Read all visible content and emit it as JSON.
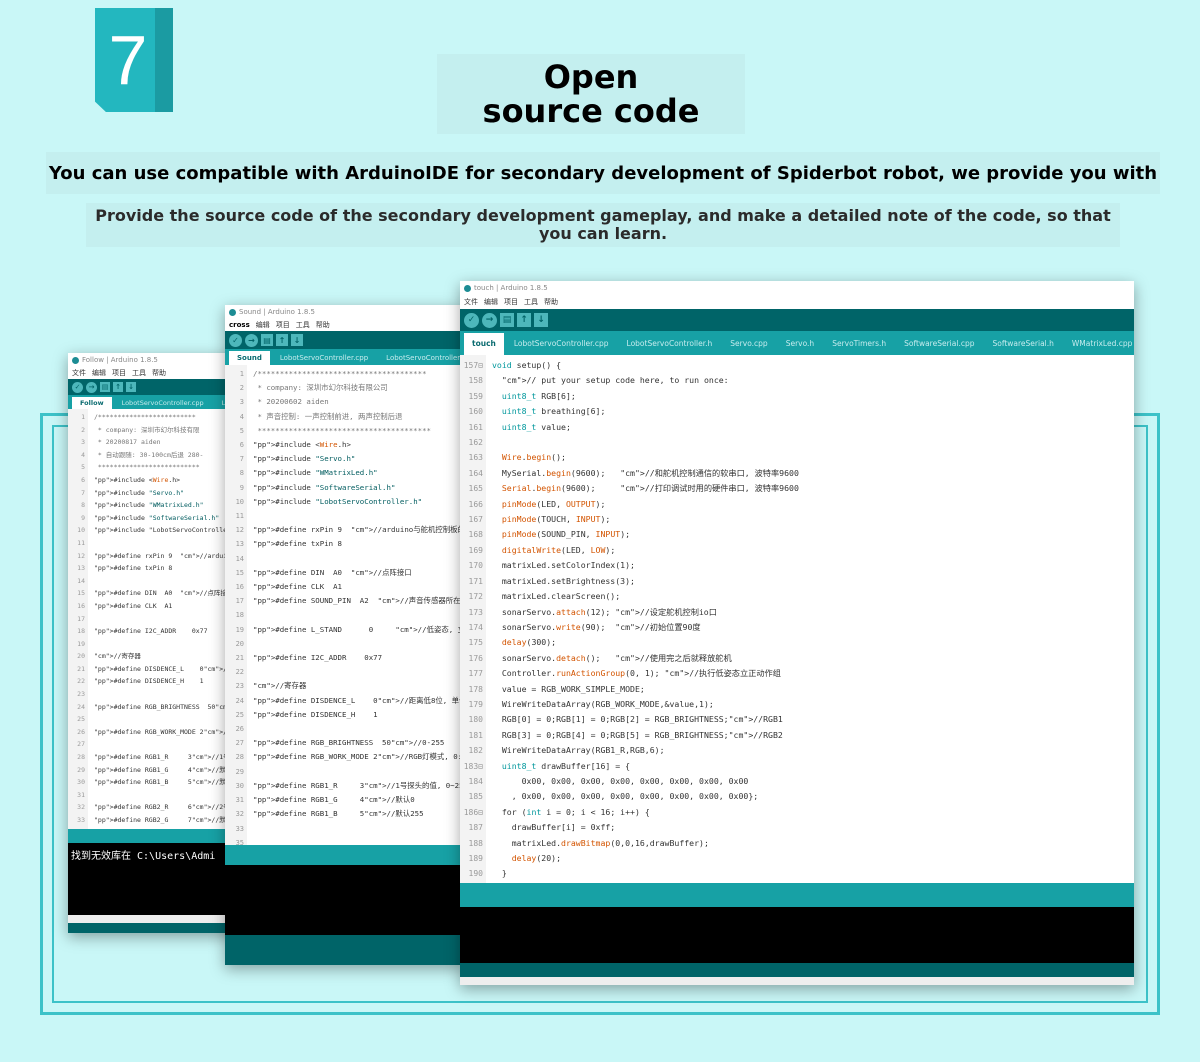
{
  "header": {
    "badge_number": "7",
    "title": "Open source code",
    "subtitle": "You can use compatible with ArduinoIDE for secondary development of Spiderbot robot, we provide you with",
    "description": "Provide the source code of the secondary development gameplay, and make a detailed note of the code, so that you can learn."
  },
  "window_left": {
    "title": "Follow | Arduino 1.8.5",
    "menu": [
      "文件",
      "编辑",
      "项目",
      "工具",
      "帮助"
    ],
    "tabs": [
      "Follow",
      "LobotServoController.cpp",
      "Lob"
    ],
    "lines": [
      "1",
      "2",
      "3",
      "4",
      "5",
      "6",
      "7",
      "8",
      "9",
      "10",
      "11",
      "12",
      "13",
      "14",
      "15",
      "16",
      "17",
      "18",
      "19",
      "20",
      "21",
      "22",
      "23",
      "24",
      "25",
      "26",
      "27",
      "28",
      "29",
      "30",
      "31",
      "32",
      "33"
    ],
    "code": [
      "/*************************",
      " * company: 深圳市幻尔科技有限",
      " * 20200817 aiden",
      " * 自动跟随: 30-100cm后退 280-",
      " **************************",
      "#include <Wire.h>",
      "#include \"Servo.h\"",
      "#include \"WMatrixLed.h\"",
      "#include \"SoftwareSerial.h\"",
      "#include \"LobotServoControlle",
      "",
      "#define rxPin 9  //arduino与舵",
      "#define txPin 8",
      "",
      "#define DIN  A0  //点阵接口",
      "#define CLK  A1",
      "",
      "#define I2C_ADDR    0x77",
      "",
      "//寄存器",
      "#define DISDENCE_L    0//距离",
      "#define DISDENCE_H    1",
      "",
      "#define RGB_BRIGHTNESS  50//0",
      "",
      "#define RGB_WORK_MODE 2//RGB",
      "",
      "#define RGB1_R     3//1号探头",
      "#define RGB1_G     4//默认0",
      "#define RGB1_B     5//默认255",
      "",
      "#define RGB2_R     6//2号探头",
      "#define RGB2_G     7//默认0"
    ],
    "console": "找到无效库在 C:\\Users\\Admi"
  },
  "window_mid": {
    "title": "Sound | Arduino 1.8.5",
    "menu_first": "cross",
    "menu": [
      "编辑",
      "项目",
      "工具",
      "帮助"
    ],
    "tabs": [
      "Sound",
      "LobotServoController.cpp",
      "LobotServoController"
    ],
    "lines": [
      "1",
      "2",
      "3",
      "4",
      "5",
      "6",
      "7",
      "8",
      "9",
      "10",
      "11",
      "12",
      "13",
      "14",
      "15",
      "16",
      "17",
      "18",
      "19",
      "20",
      "21",
      "22",
      "23",
      "24",
      "25",
      "26",
      "27",
      "28",
      "29",
      "30",
      "31",
      "32",
      "33"
    ],
    "code": [
      "/**************************************",
      " * company: 深圳市幻尔科技有限公司",
      " * 20200602 aiden",
      " * 声音控制: 一声控制前进, 两声控制后退",
      " ***************************************",
      "#include <Wire.h>",
      "#include \"Servo.h\"",
      "#include \"WMatrixLed.h\"",
      "#include \"SoftwareSerial.h\"",
      "#include \"LobotServoController.h\"",
      "",
      "#define rxPin 9  //arduino与舵机控制板的串",
      "#define txPin 8",
      "",
      "#define DIN  A0  //点阵接口",
      "#define CLK  A1",
      "#define SOUND_PIN  A2  //声音传感器所在",
      "",
      "#define L_STAND      0     //低姿态, 立正",
      "",
      "#define I2C_ADDR    0x77",
      "",
      "//寄存器",
      "#define DISDENCE_L    0//距离低8位, 单位m",
      "#define DISDENCE_H    1",
      "",
      "#define RGB_BRIGHTNESS  50//0-255",
      "#define RGB_WORK_MODE 2//RGB灯模式, 0: 用",
      "",
      "#define RGB1_R     3//1号探头的值, 0~255",
      "#define RGB1_G     4//默认0",
      "#define RGB1_B     5//默认255",
      ""
    ],
    "extra_line": "35"
  },
  "window_right": {
    "title": "touch | Arduino 1.8.5",
    "menu": [
      "文件",
      "编辑",
      "项目",
      "工具",
      "帮助"
    ],
    "tabs": [
      "touch",
      "LobotServoController.cpp",
      "LobotServoController.h",
      "Servo.cpp",
      "Servo.h",
      "ServoTimers.h",
      "SoftwareSerial.cpp",
      "SoftwareSerial.h",
      "WMatrixLed.cpp"
    ],
    "lines": [
      "157⊟",
      "158",
      "159",
      "160",
      "161",
      "162",
      "163",
      "164",
      "165",
      "166",
      "167",
      "168",
      "169",
      "170",
      "171",
      "172",
      "173",
      "174",
      "175",
      "176",
      "177",
      "178",
      "179",
      "180",
      "181",
      "182",
      "183⊟",
      "184",
      "185",
      "186⊟",
      "187",
      "188",
      "189",
      "190"
    ],
    "code": [
      "void setup() {",
      "  // put your setup code here, to run once:",
      "  uint8_t RGB[6];",
      "  uint8_t breathing[6];",
      "  uint8_t value;",
      "",
      "  Wire.begin();",
      "  MySerial.begin(9600);   //和舵机控制通信的软串口, 波特率9600",
      "  Serial.begin(9600);     //打印调试时用的硬件串口, 波特率9600",
      "  pinMode(LED, OUTPUT);",
      "  pinMode(TOUCH, INPUT);",
      "  pinMode(SOUND_PIN, INPUT);",
      "  digitalWrite(LED, LOW);",
      "  matrixLed.setColorIndex(1);",
      "  matrixLed.setBrightness(3);",
      "  matrixLed.clearScreen();",
      "  sonarServo.attach(12); //设定舵机控制io口",
      "  sonarServo.write(90);  //初始位置90度",
      "  delay(300);",
      "  sonarServo.detach();   //使用完之后就释放舵机",
      "  Controller.runActionGroup(0, 1); //执行低姿态立正动作组",
      "  value = RGB_WORK_SIMPLE_MODE;",
      "  WireWriteDataArray(RGB_WORK_MODE,&value,1);",
      "  RGB[0] = 0;RGB[1] = 0;RGB[2] = RGB_BRIGHTNESS;//RGB1",
      "  RGB[3] = 0;RGB[4] = 0;RGB[5] = RGB_BRIGHTNESS;//RGB2",
      "  WireWriteDataArray(RGB1_R,RGB,6);",
      "  uint8_t drawBuffer[16] = {",
      "      0x00, 0x00, 0x00, 0x00, 0x00, 0x00, 0x00, 0x00",
      "    , 0x00, 0x00, 0x00, 0x00, 0x00, 0x00, 0x00, 0x00};",
      "  for (int i = 0; i < 16; i++) {",
      "    drawBuffer[i] = 0xff;",
      "    matrixLed.drawBitmap(0,0,16,drawBuffer);",
      "    delay(20);",
      "  }"
    ]
  }
}
